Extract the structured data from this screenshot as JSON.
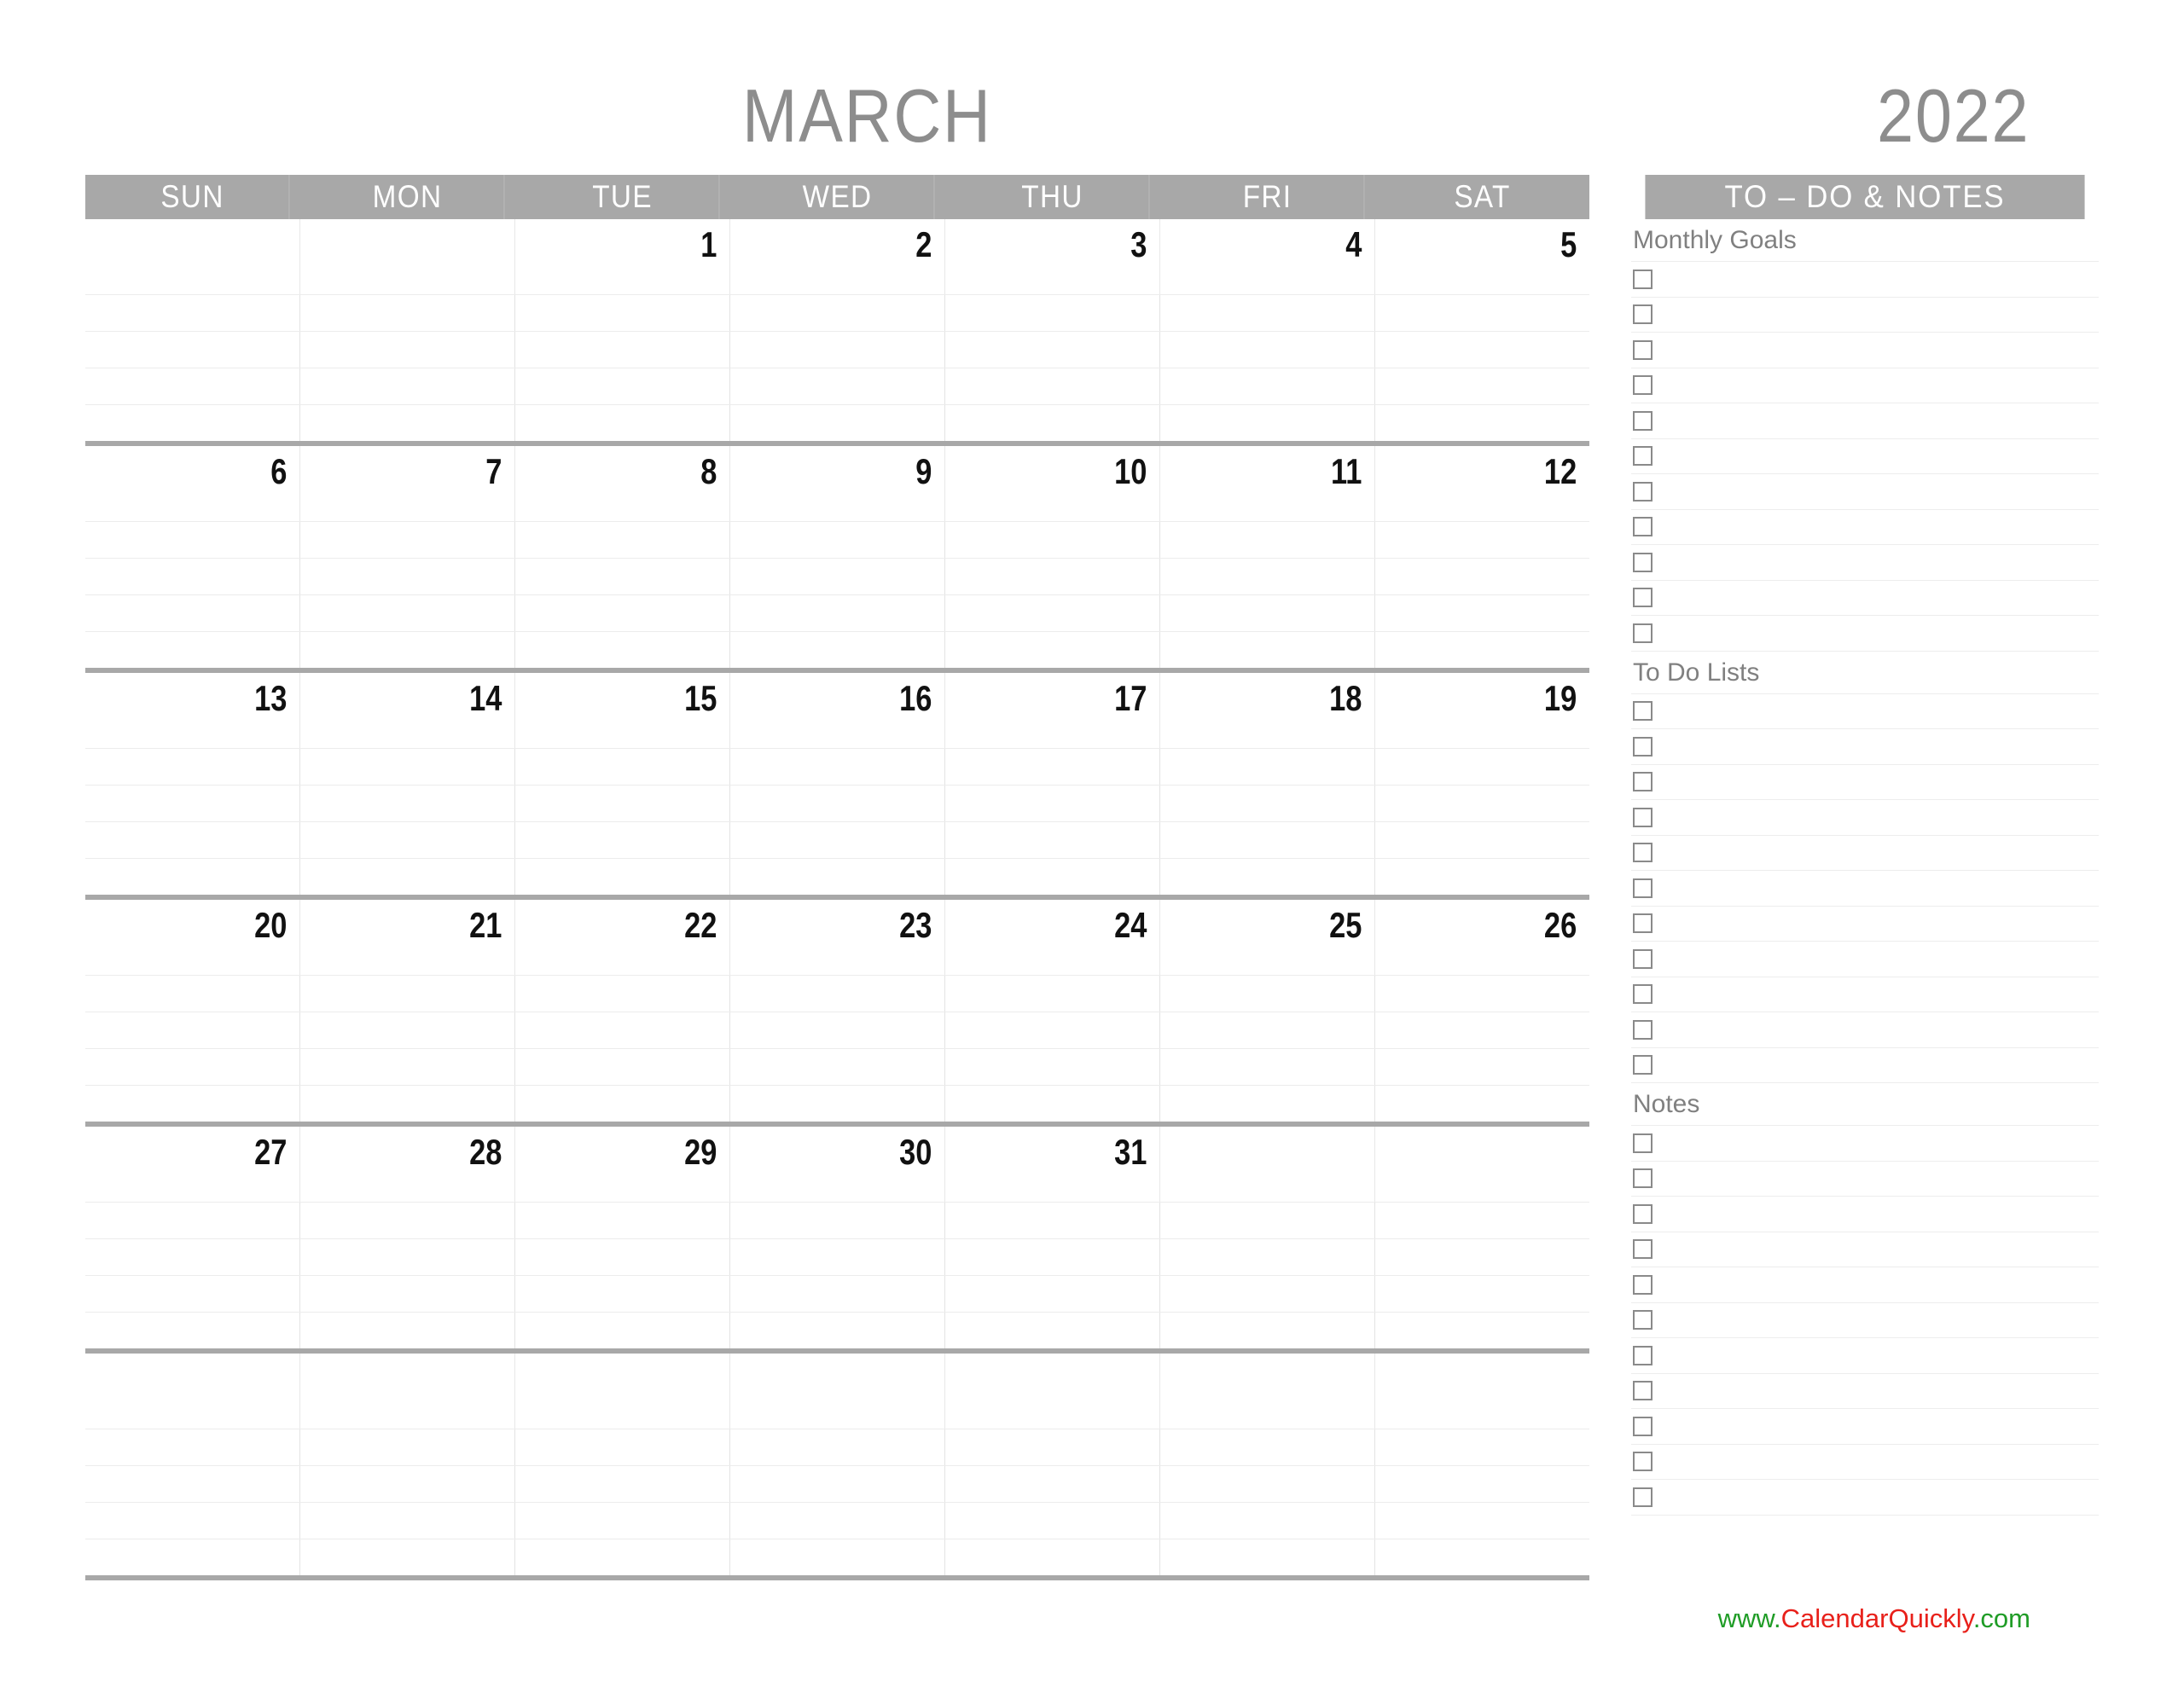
{
  "title": {
    "month": "MARCH",
    "year": "2022"
  },
  "calendar": {
    "day_headers": [
      "SUN",
      "MON",
      "TUE",
      "WED",
      "THU",
      "FRI",
      "SAT"
    ],
    "lines_per_week": 4,
    "weeks": [
      [
        "",
        "",
        "1",
        "2",
        "3",
        "4",
        "5"
      ],
      [
        "6",
        "7",
        "8",
        "9",
        "10",
        "11",
        "12"
      ],
      [
        "13",
        "14",
        "15",
        "16",
        "17",
        "18",
        "19"
      ],
      [
        "20",
        "21",
        "22",
        "23",
        "24",
        "25",
        "26"
      ],
      [
        "27",
        "28",
        "29",
        "30",
        "31",
        "",
        ""
      ],
      [
        "",
        "",
        "",
        "",
        "",
        "",
        ""
      ]
    ]
  },
  "sidebar": {
    "header": "TO – DO & NOTES",
    "sections": [
      {
        "label": "Monthly Goals",
        "rows": 11
      },
      {
        "label": "To Do Lists",
        "rows": 11
      },
      {
        "label": "Notes",
        "rows": 11
      }
    ]
  },
  "footer": {
    "prefix": "www.",
    "brand": "CalendarQuickly",
    "suffix": ".com"
  },
  "colors": {
    "header_gray": "#a8a8a8",
    "title_gray": "#8d8d8d",
    "label_gray": "#808080",
    "line_gray": "#e3e3e3",
    "date_black": "#111111",
    "url_green": "#1f9c26",
    "url_red": "#e8201a"
  }
}
